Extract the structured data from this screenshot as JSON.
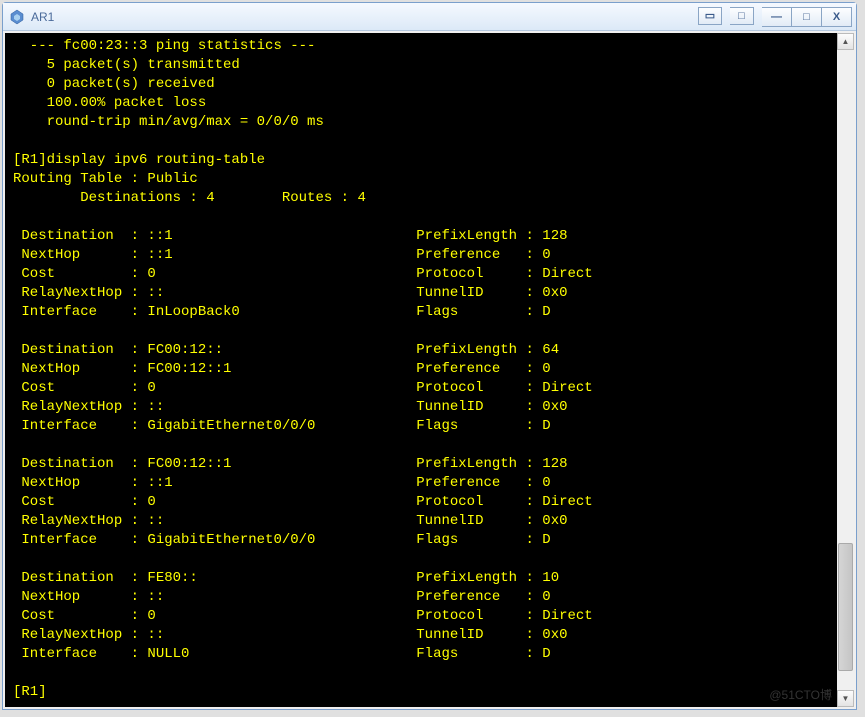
{
  "window": {
    "title": "AR1"
  },
  "ping": {
    "header": "  --- fc00:23::3 ping statistics ---",
    "transmitted": "    5 packet(s) transmitted",
    "received": "    0 packet(s) received",
    "loss": "    100.00% packet loss",
    "rtt": "    round-trip min/avg/max = 0/0/0 ms"
  },
  "cmd": {
    "display": "[R1]display ipv6 routing-table",
    "table_header": "Routing Table : Public",
    "summary": "\tDestinations : 4\tRoutes : 4",
    "prompt": "[R1]"
  },
  "routes": [
    {
      "Destination": "::1",
      "PrefixLength": "128",
      "NextHop": "::1",
      "Preference": "0",
      "Cost": "0",
      "Protocol": "Direct",
      "RelayNextHop": "::",
      "TunnelID": "0x0",
      "Interface": "InLoopBack0",
      "Flags": "D"
    },
    {
      "Destination": "FC00:12::",
      "PrefixLength": "64",
      "NextHop": "FC00:12::1",
      "Preference": "0",
      "Cost": "0",
      "Protocol": "Direct",
      "RelayNextHop": "::",
      "TunnelID": "0x0",
      "Interface": "GigabitEthernet0/0/0",
      "Flags": "D"
    },
    {
      "Destination": "FC00:12::1",
      "PrefixLength": "128",
      "NextHop": "::1",
      "Preference": "0",
      "Cost": "0",
      "Protocol": "Direct",
      "RelayNextHop": "::",
      "TunnelID": "0x0",
      "Interface": "GigabitEthernet0/0/0",
      "Flags": "D"
    },
    {
      "Destination": "FE80::",
      "PrefixLength": "10",
      "NextHop": "::",
      "Preference": "0",
      "Cost": "0",
      "Protocol": "Direct",
      "RelayNextHop": "::",
      "TunnelID": "0x0",
      "Interface": "NULL0",
      "Flags": "D"
    }
  ],
  "labels": {
    "Destination": "Destination ",
    "NextHop": "NextHop     ",
    "Cost": "Cost        ",
    "RelayNextHop": "RelayNextHop",
    "Interface": "Interface   ",
    "PrefixLength": "PrefixLength",
    "Preference": "Preference  ",
    "Protocol": "Protocol    ",
    "TunnelID": "TunnelID    ",
    "Flags": "Flags       "
  },
  "watermark": "@51CTO博"
}
